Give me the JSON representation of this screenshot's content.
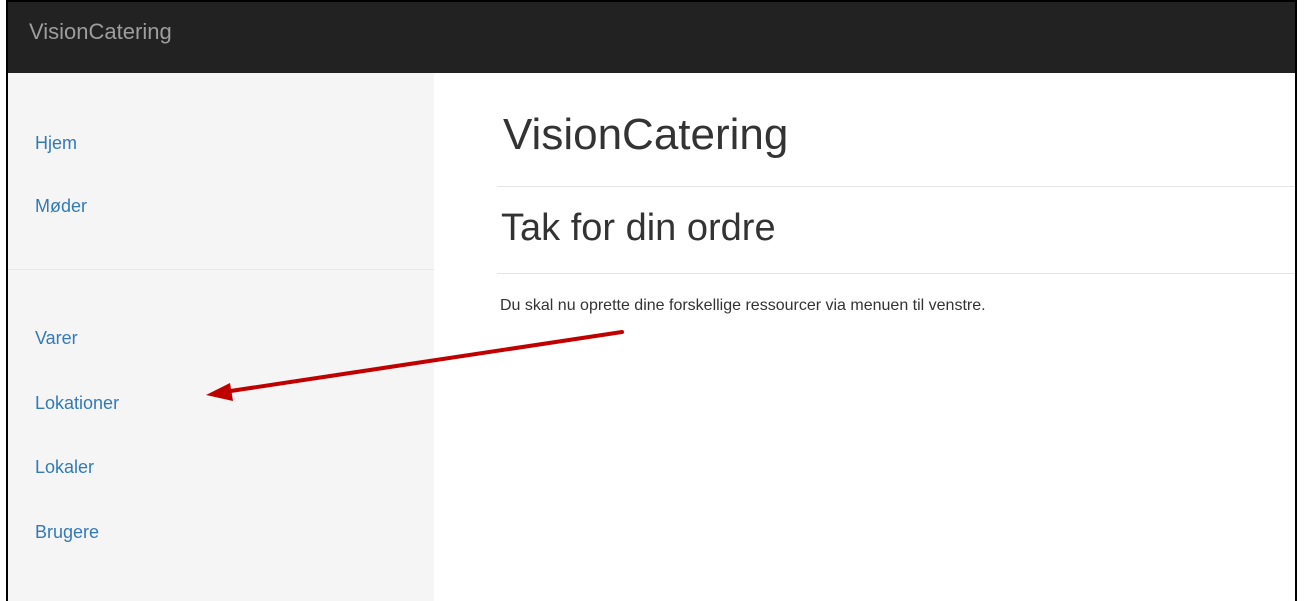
{
  "navbar": {
    "brand": "VisionCatering"
  },
  "sidebar": {
    "items": [
      {
        "label": "Hjem"
      },
      {
        "label": "Møder"
      },
      {
        "label": "Varer"
      },
      {
        "label": "Lokationer"
      },
      {
        "label": "Lokaler"
      },
      {
        "label": "Brugere"
      }
    ]
  },
  "main": {
    "title": "VisionCatering",
    "subtitle": "Tak for din ordre",
    "message": "Du skal nu oprette dine forskellige ressourcer via menuen til venstre."
  },
  "colors": {
    "navbar_bg": "#222222",
    "brand_text": "#9d9d9d",
    "sidebar_bg": "#f5f5f5",
    "link": "#337ab7",
    "annotation_arrow": "#c00000"
  },
  "icons": {
    "annotation": "red-arrow-icon"
  }
}
